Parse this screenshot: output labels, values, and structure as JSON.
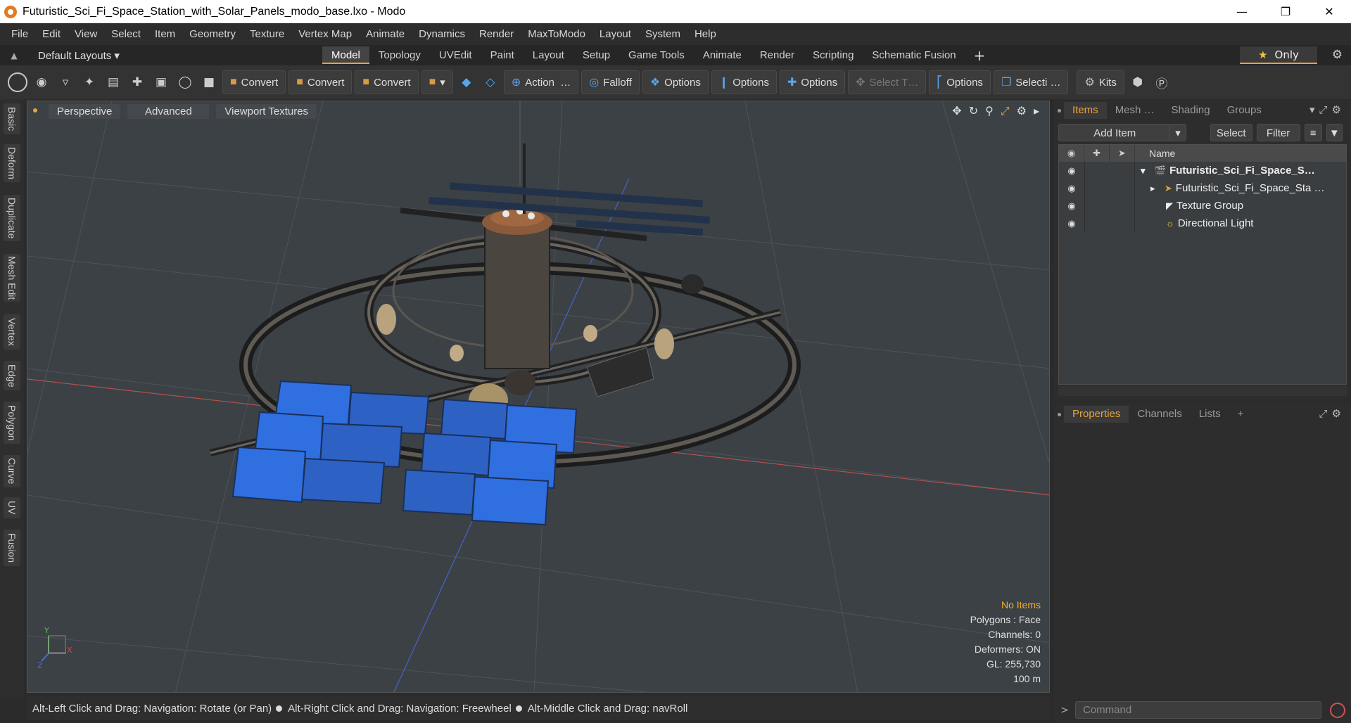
{
  "window": {
    "title": "Futuristic_Sci_Fi_Space_Station_with_Solar_Panels_modo_base.lxo - Modo",
    "min_label": "—",
    "max_label": "❐",
    "close_label": "✕"
  },
  "menu": [
    "File",
    "Edit",
    "View",
    "Select",
    "Item",
    "Geometry",
    "Texture",
    "Vertex Map",
    "Animate",
    "Dynamics",
    "Render",
    "MaxToModo",
    "Layout",
    "System",
    "Help"
  ],
  "layout": {
    "preset": "Default Layouts ▾",
    "tabs": [
      "Model",
      "Topology",
      "UVEdit",
      "Paint",
      "Layout",
      "Setup",
      "Game Tools",
      "Animate",
      "Render",
      "Scripting",
      "Schematic Fusion"
    ],
    "active_tab": "Model",
    "plus": "+",
    "only_label": "Only"
  },
  "toolbar": {
    "convert1": "Convert",
    "convert2": "Convert",
    "convert3": "Convert",
    "action": "Action",
    "action_more": "…",
    "falloff": "Falloff",
    "options1": "Options",
    "options2": "Options",
    "options3": "Options",
    "select_t": "Select T…",
    "options4": "Options",
    "selecti": "Selecti …",
    "kits": "Kits"
  },
  "left_tabs": [
    "Basic",
    "Deform",
    "Duplicate",
    "Mesh Edit",
    "Vertex",
    "Edge",
    "Polygon",
    "Curve",
    "UV",
    "Fusion"
  ],
  "viewport": {
    "view": "Perspective",
    "shading": "Advanced",
    "textures": "Viewport Textures",
    "stats": {
      "items": "No Items",
      "polygons": "Polygons : Face",
      "channels": "Channels: 0",
      "deformers": "Deformers: ON",
      "gl": "GL: 255,730",
      "scale": "100 m"
    },
    "axis": {
      "y": "Y",
      "x": "X",
      "z": "Z"
    }
  },
  "status": {
    "hint1": "Alt-Left Click and Drag: Navigation: Rotate (or Pan)",
    "hint2": "Alt-Right Click and Drag: Navigation: Freewheel",
    "hint3": "Alt-Middle Click and Drag: navRoll"
  },
  "items_panel": {
    "tabs": [
      "Items",
      "Mesh …",
      "Shading",
      "Groups"
    ],
    "add_item": "Add Item",
    "select": "Select",
    "filter": "Filter",
    "name_header": "Name",
    "rows": [
      {
        "label": "Futuristic_Sci_Fi_Space_S…",
        "icon": "scene-icon"
      },
      {
        "label": "Futuristic_Sci_Fi_Space_Sta …",
        "icon": "mesh-icon"
      },
      {
        "label": "Texture Group",
        "icon": "texture-group-icon"
      },
      {
        "label": "Directional Light",
        "icon": "light-icon"
      }
    ]
  },
  "props_panel": {
    "tabs": [
      "Properties",
      "Channels",
      "Lists"
    ],
    "plus": "+"
  },
  "command": {
    "placeholder": "Command"
  },
  "colors": {
    "accent": "#e8a33c",
    "viewport_bg": "#3b4145",
    "panel_blue": "#2f6fe0",
    "x_axis": "#c0504d",
    "z_axis": "#4a6fd0"
  }
}
